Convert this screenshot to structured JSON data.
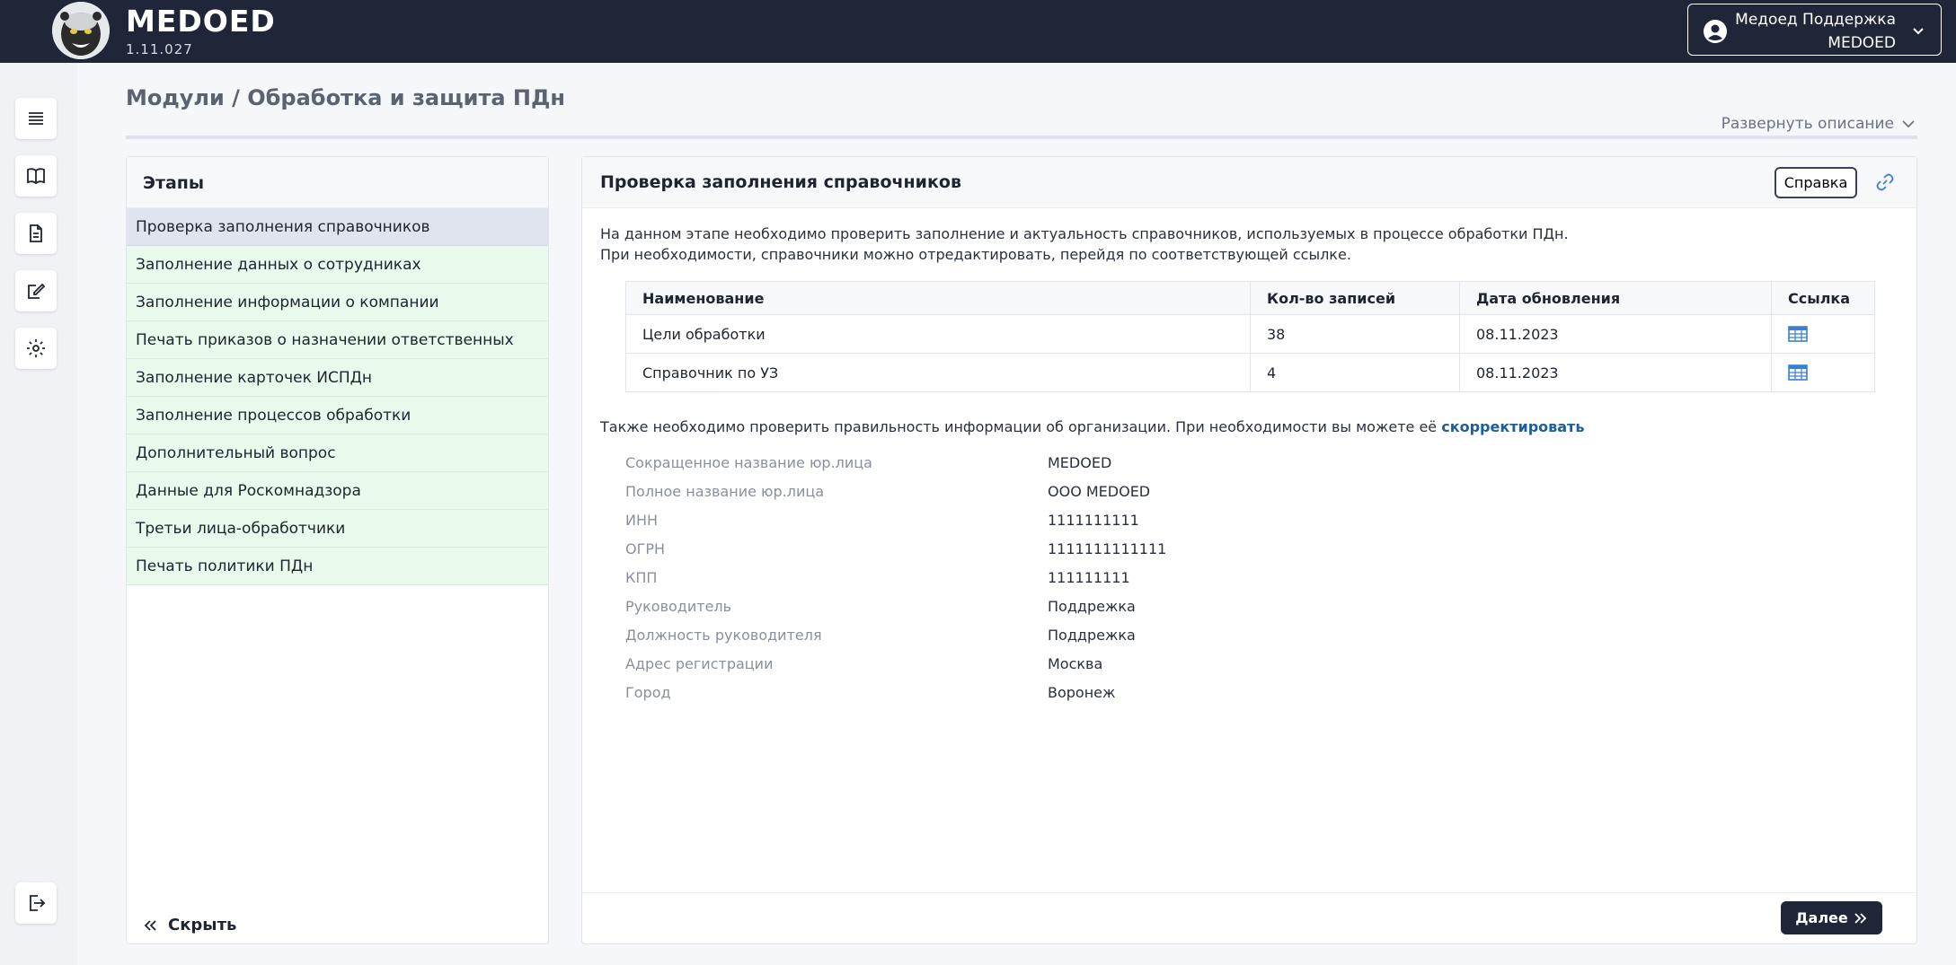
{
  "app": {
    "name": "MEDOED",
    "version": "1.11.027"
  },
  "user": {
    "name": "Медоед Поддержка",
    "org": "MEDOED",
    "icon": "user-circle-icon"
  },
  "rail": [
    {
      "icon": "list-icon"
    },
    {
      "icon": "book-icon"
    },
    {
      "icon": "document-icon"
    },
    {
      "icon": "edit-icon"
    },
    {
      "icon": "gear-icon"
    }
  ],
  "rail_logout": {
    "icon": "logout-icon"
  },
  "breadcrumb": "Модули / Обработка и защита ПДн",
  "expand_label": "Развернуть описание",
  "stages": {
    "title": "Этапы",
    "items": [
      "Проверка заполнения справочников",
      "Заполнение данных о сотрудниках",
      "Заполнение информации о компании",
      "Печать приказов о назначении ответственных",
      "Заполнение карточек ИСПДн",
      "Заполнение процессов обработки",
      "Дополнительный вопрос",
      "Данные для Роскомнадзора",
      "Третьи лица-обработчики",
      "Печать политики ПДн"
    ],
    "active_index": 0,
    "hide_label": "Скрыть"
  },
  "content": {
    "title": "Проверка заполнения справочников",
    "help_label": "Справка",
    "intro_line1": "На данном этапе необходимо проверить заполнение и актуальность справочников, используемых в процессе обработки ПДн.",
    "intro_line2": "При необходимости, справочники можно отредактировать, перейдя по соответствующей ссылке.",
    "table": {
      "headers": [
        "Наименование",
        "Кол-во записей",
        "Дата обновления",
        "Ссылка"
      ],
      "rows": [
        {
          "name": "Цели обработки",
          "count": "38",
          "date": "08.11.2023"
        },
        {
          "name": "Справочник по УЗ",
          "count": "4",
          "date": "08.11.2023"
        }
      ]
    },
    "org_note": "Также необходимо проверить правильность информации об организации. При необходимости вы можете её",
    "org_note_link": "скорректировать",
    "org_info": [
      {
        "label": "Сокращенное название юр.лица",
        "value": "MEDOED"
      },
      {
        "label": "Полное название юр.лица",
        "value": "ООО MEDOED"
      },
      {
        "label": "ИНН",
        "value": "1111111111"
      },
      {
        "label": "ОГРН",
        "value": "1111111111111"
      },
      {
        "label": "КПП",
        "value": "111111111"
      },
      {
        "label": "Руководитель",
        "value": "Поддрежка"
      },
      {
        "label": "Должность руководителя",
        "value": "Поддрежка"
      },
      {
        "label": "Адрес регистрации",
        "value": "Москва"
      },
      {
        "label": "Город",
        "value": "Воронеж"
      }
    ],
    "next_label": "Далее"
  },
  "colors": {
    "header_bg": "#1f2637",
    "stage_done": "#e9f9ec",
    "stage_active": "#e0e4ee",
    "link": "#1c5f9a"
  }
}
